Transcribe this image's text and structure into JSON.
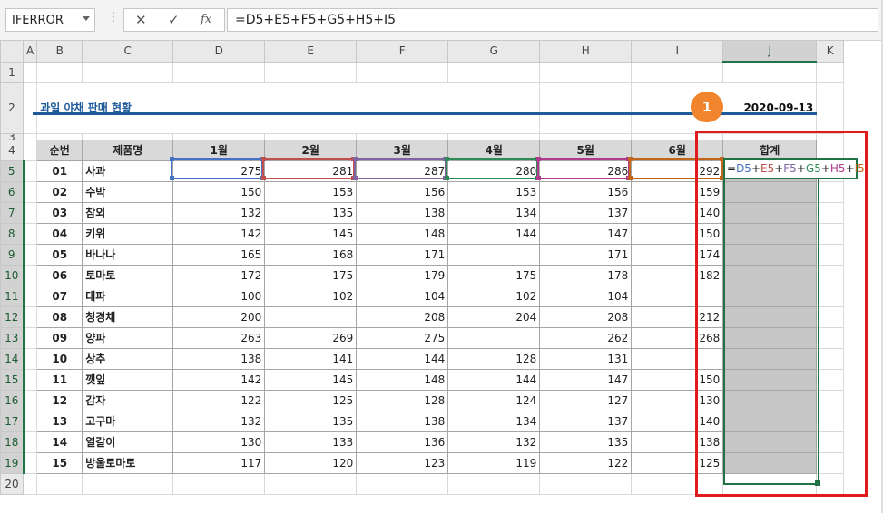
{
  "name_box": "IFERROR",
  "formula_bar": {
    "cancel_icon": "x-icon",
    "enter_icon": "check-icon",
    "fx_label": "fx",
    "formula": "=D5+E5+F5+G5+H5+I5"
  },
  "columns": [
    "A",
    "B",
    "C",
    "D",
    "E",
    "F",
    "G",
    "H",
    "I",
    "J",
    "K"
  ],
  "sheet": {
    "title": "과일 야채 판매 현황",
    "date": "2020-09-13",
    "headers": [
      "순번",
      "제품명",
      "1월",
      "2월",
      "3월",
      "4월",
      "5월",
      "6월",
      "합계"
    ],
    "rows": [
      {
        "row": "5",
        "no": "01",
        "name": "사과",
        "m1": "275",
        "m2": "281",
        "m3": "287",
        "m4": "280",
        "m5": "286",
        "m6": "292"
      },
      {
        "row": "6",
        "no": "02",
        "name": "수박",
        "m1": "150",
        "m2": "153",
        "m3": "156",
        "m4": "153",
        "m5": "156",
        "m6": "159"
      },
      {
        "row": "7",
        "no": "03",
        "name": "참외",
        "m1": "132",
        "m2": "135",
        "m3": "138",
        "m4": "134",
        "m5": "137",
        "m6": "140"
      },
      {
        "row": "8",
        "no": "04",
        "name": "키위",
        "m1": "142",
        "m2": "145",
        "m3": "148",
        "m4": "144",
        "m5": "147",
        "m6": "150"
      },
      {
        "row": "9",
        "no": "05",
        "name": "바나나",
        "m1": "165",
        "m2": "168",
        "m3": "171",
        "m4": "",
        "m5": "171",
        "m6": "174"
      },
      {
        "row": "10",
        "no": "06",
        "name": "토마토",
        "m1": "172",
        "m2": "175",
        "m3": "179",
        "m4": "175",
        "m5": "178",
        "m6": "182"
      },
      {
        "row": "11",
        "no": "07",
        "name": "대파",
        "m1": "100",
        "m2": "102",
        "m3": "104",
        "m4": "102",
        "m5": "104",
        "m6": ""
      },
      {
        "row": "12",
        "no": "08",
        "name": "청경채",
        "m1": "200",
        "m2": "",
        "m3": "208",
        "m4": "204",
        "m5": "208",
        "m6": "212"
      },
      {
        "row": "13",
        "no": "09",
        "name": "양파",
        "m1": "263",
        "m2": "269",
        "m3": "275",
        "m4": "",
        "m5": "262",
        "m6": "268"
      },
      {
        "row": "14",
        "no": "10",
        "name": "상추",
        "m1": "138",
        "m2": "141",
        "m3": "144",
        "m4": "128",
        "m5": "131",
        "m6": ""
      },
      {
        "row": "15",
        "no": "11",
        "name": "깻잎",
        "m1": "142",
        "m2": "145",
        "m3": "148",
        "m4": "144",
        "m5": "147",
        "m6": "150"
      },
      {
        "row": "16",
        "no": "12",
        "name": "감자",
        "m1": "122",
        "m2": "125",
        "m3": "128",
        "m4": "124",
        "m5": "127",
        "m6": "130"
      },
      {
        "row": "17",
        "no": "13",
        "name": "고구마",
        "m1": "132",
        "m2": "135",
        "m3": "138",
        "m4": "134",
        "m5": "137",
        "m6": "140"
      },
      {
        "row": "18",
        "no": "14",
        "name": "열갈이",
        "m1": "130",
        "m2": "133",
        "m3": "136",
        "m4": "132",
        "m5": "135",
        "m6": "138"
      },
      {
        "row": "19",
        "no": "15",
        "name": "방울토마토",
        "m1": "117",
        "m2": "120",
        "m3": "123",
        "m4": "119",
        "m5": "122",
        "m6": "125"
      }
    ]
  },
  "editing_cell": {
    "prefix": "=",
    "parts": [
      {
        "ref": "D5",
        "color": "#4472c4"
      },
      {
        "ref": "E5",
        "color": "#c0504d"
      },
      {
        "ref": "F5",
        "color": "#8064a2"
      },
      {
        "ref": "G5",
        "color": "#2e8b57"
      },
      {
        "ref": "H5",
        "color": "#b03a8c"
      },
      {
        "ref": "I5",
        "color": "#c0651a"
      }
    ],
    "plus": "+"
  },
  "callout_number": "1",
  "colors": {
    "title": "#1f5a99",
    "accent_green": "#217346",
    "callout": "#f0852e",
    "highlight_box": "#e01b1b"
  }
}
